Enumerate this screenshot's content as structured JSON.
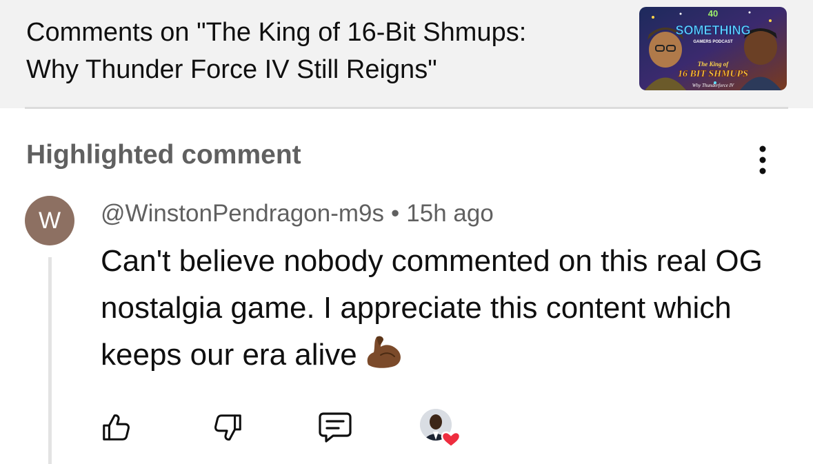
{
  "header": {
    "title": "Comments on \"The King of 16-Bit Shmups:\nWhy Thunder Force IV Still Reigns\"",
    "thumbnail": {
      "badge": "40",
      "brand": "SOMETHING",
      "brand_sub": "GAMERS PODCAST",
      "line1": "The King of",
      "line2": "16 BIT SHMUPS",
      "line3": "Why Thunderforce IV"
    }
  },
  "section": {
    "label": "Highlighted comment",
    "menu_icon": "vertical-dots-icon"
  },
  "comment": {
    "avatar_letter": "W",
    "avatar_color": "#8d7062",
    "author": "@WinstonPendragon-m9s",
    "separator": "•",
    "time": "15h ago",
    "text": "Can't believe nobody commented on this real OG nostalgia game. I appreciate this content which keeps our era alive",
    "emoji": "flexed-biceps-icon"
  },
  "actions": {
    "like_icon": "thumbs-up-icon",
    "dislike_icon": "thumbs-down-icon",
    "reply_icon": "reply-comment-icon",
    "creator_heart_icon": "creator-heart-icon",
    "heart_color": "#ee2d3f"
  }
}
